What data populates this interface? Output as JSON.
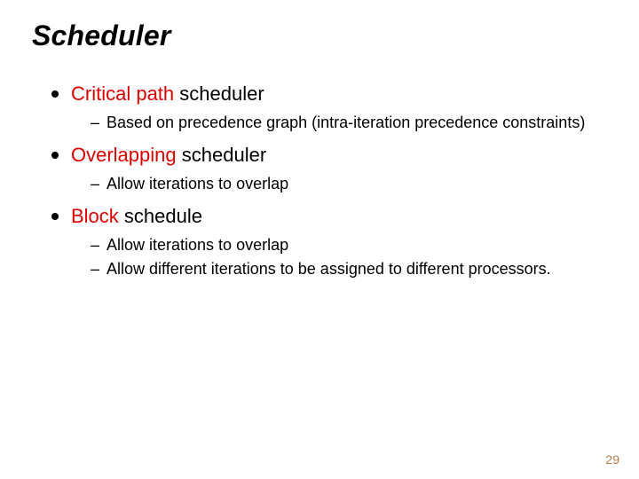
{
  "title": "Scheduler",
  "items": [
    {
      "heading_prefix": "Critical path",
      "heading_rest": " scheduler",
      "sub": [
        "Based on precedence graph (intra-iteration precedence constraints)"
      ]
    },
    {
      "heading_prefix": "Overlapping",
      "heading_rest": " scheduler",
      "sub": [
        "Allow iterations to overlap"
      ]
    },
    {
      "heading_prefix": "Block",
      "heading_rest": " schedule",
      "sub": [
        "Allow iterations to overlap",
        "Allow different iterations to be assigned to different processors."
      ]
    }
  ],
  "page_number": "29"
}
